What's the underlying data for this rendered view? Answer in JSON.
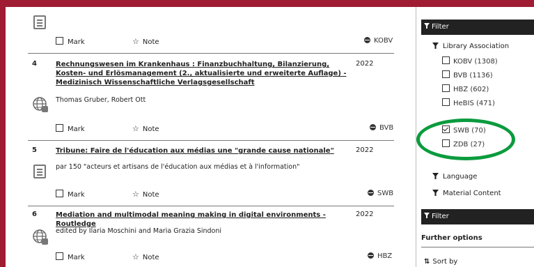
{
  "results": [
    {
      "mark_label": "Mark",
      "note_label": "Note",
      "source": "KOBV"
    },
    {
      "number": "4",
      "title": "Rechnungswesen im Krankenhaus : Finanzbuchhaltung, Bilanzierung, Kosten- und Erlösmanagement (2., aktualisierte und erweiterte Auflage) - Medizinisch Wissenschaftliche Verlagsgesellschaft",
      "year": "2022",
      "subtitle": "Thomas Gruber, Robert Ott",
      "mark_label": "Mark",
      "note_label": "Note",
      "source": "BVB"
    },
    {
      "number": "5",
      "title": "Tribune: Faire de l'éducation aux médias une \"grande cause nationale\"",
      "year": "2022",
      "subtitle": "par 150 \"acteurs et artisans de l'éducation aux médias et à l'information\"",
      "mark_label": "Mark",
      "note_label": "Note",
      "source": "SWB"
    },
    {
      "number": "6",
      "title": "Mediation and multimodal meaning making in digital environments - Routledge",
      "year": "2022",
      "subtitle": "edited by Ilaria Moschini and Maria Grazia Sindoni",
      "mark_label": "Mark",
      "note_label": "Note",
      "source": "HBZ"
    }
  ],
  "sidebar": {
    "filter_header": "Filter",
    "library_association": {
      "label": "Library Association",
      "options": [
        {
          "label": "KOBV (1308)",
          "checked": false
        },
        {
          "label": "BVB (1136)",
          "checked": false
        },
        {
          "label": "HBZ (602)",
          "checked": false
        },
        {
          "label": "HeBIS (471)",
          "checked": false
        },
        {
          "label": "SWB (70)",
          "checked": true
        },
        {
          "label": "ZDB (27)",
          "checked": false
        }
      ]
    },
    "language_label": "Language",
    "material_content_label": "Material Content",
    "filter_header_2": "Filter",
    "further_options": "Further options",
    "sort_by": "Sort by"
  },
  "colors": {
    "frame": "#a01c33",
    "highlight": "#0b9b3e",
    "filter_bar": "#222222"
  },
  "icons": [
    "document-icon",
    "globe-icon",
    "checkbox-icon",
    "star-icon",
    "filter-icon",
    "sort-icon"
  ]
}
